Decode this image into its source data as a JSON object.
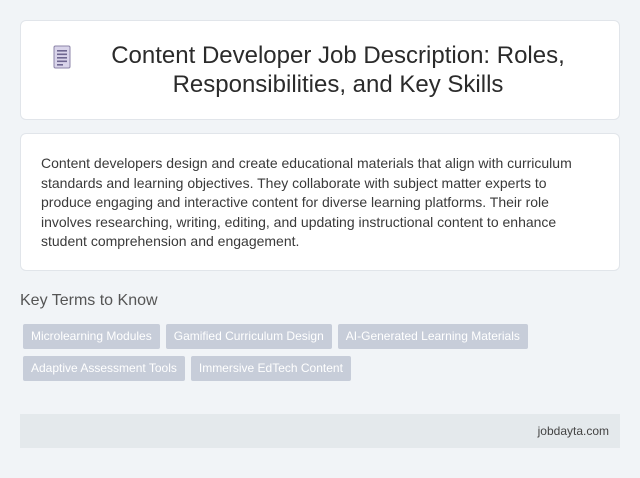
{
  "header": {
    "icon": "document-icon",
    "title": "Content Developer Job Description: Roles, Responsibilities, and Key Skills"
  },
  "description": "Content developers design and create educational materials that align with curriculum standards and learning objectives. They collaborate with subject matter experts to produce engaging and interactive content for diverse learning platforms. Their role involves researching, writing, editing, and updating instructional content to enhance student comprehension and engagement.",
  "key_terms": {
    "heading": "Key Terms to Know",
    "tags": [
      "Microlearning Modules",
      "Gamified Curriculum Design",
      "AI-Generated Learning Materials",
      "Adaptive Assessment Tools",
      "Immersive EdTech Content"
    ]
  },
  "footer": {
    "site": "jobdayta.com"
  },
  "colors": {
    "tag_bg": "#c7cdd9",
    "page_bg": "#f1f4f7",
    "footer_bg": "#e4e9ec"
  }
}
